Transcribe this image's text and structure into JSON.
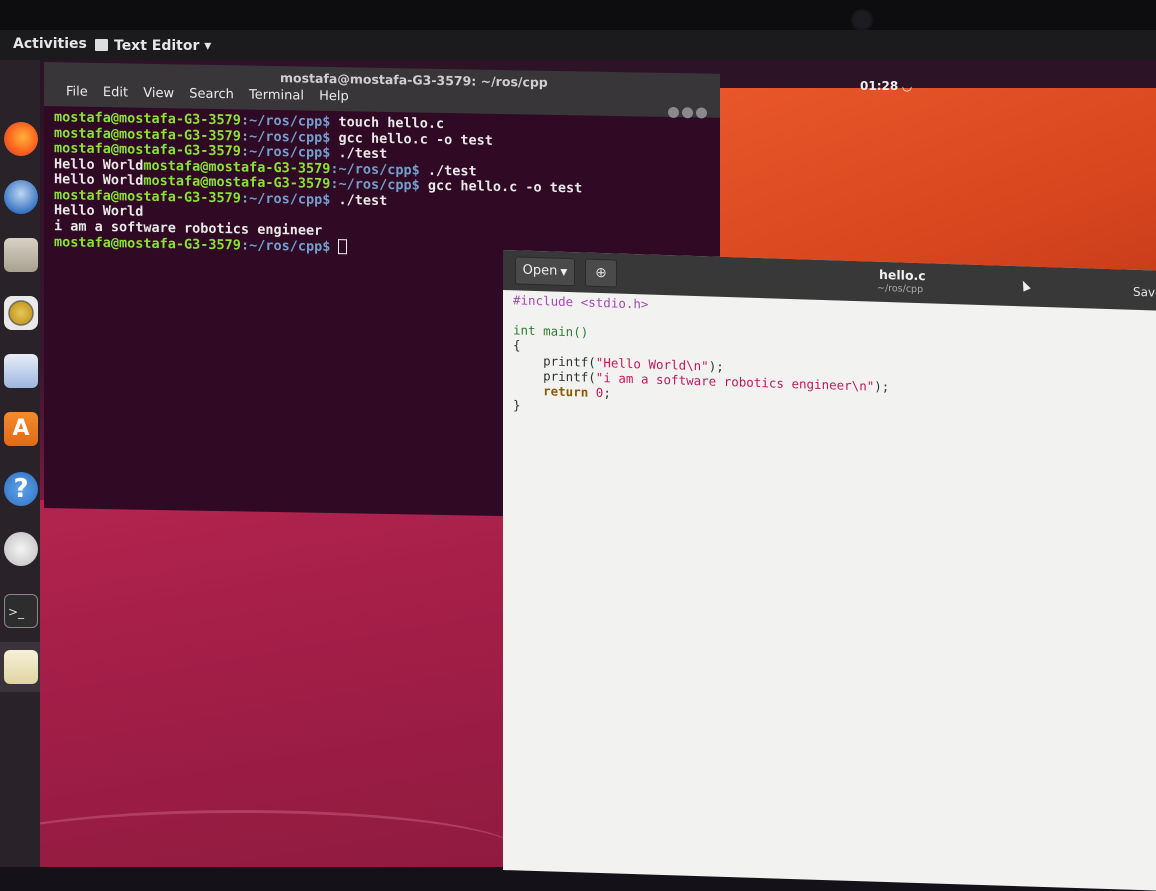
{
  "topbar": {
    "activities": "Activities",
    "app_menu": "Text Editor ▾",
    "clock": "01:28 ◡"
  },
  "terminal": {
    "title": "mostafa@mostafa-G3-3579: ~/ros/cpp",
    "menu": [
      "File",
      "Edit",
      "View",
      "Search",
      "Terminal",
      "Help"
    ],
    "lines": [
      {
        "output": "",
        "user": "mostafa@mostafa-G3-3579",
        "path": ":~/ros/cpp$",
        "cmd": " touch hello.c"
      },
      {
        "output": "",
        "user": "mostafa@mostafa-G3-3579",
        "path": ":~/ros/cpp$",
        "cmd": " gcc hello.c -o test"
      },
      {
        "output": "",
        "user": "mostafa@mostafa-G3-3579",
        "path": ":~/ros/cpp$",
        "cmd": " ./test"
      },
      {
        "output": "Hello World",
        "user": "mostafa@mostafa-G3-3579",
        "path": ":~/ros/cpp$",
        "cmd": " ./test"
      },
      {
        "output": "Hello World",
        "user": "mostafa@mostafa-G3-3579",
        "path": ":~/ros/cpp$",
        "cmd": " gcc hello.c -o test"
      },
      {
        "output": "",
        "user": "mostafa@mostafa-G3-3579",
        "path": ":~/ros/cpp$",
        "cmd": " ./test"
      },
      {
        "output": "Hello World",
        "user": "",
        "path": "",
        "cmd": ""
      },
      {
        "output": "i am a software robotics engineer",
        "user": "",
        "path": "",
        "cmd": ""
      },
      {
        "output": "",
        "user": "mostafa@mostafa-G3-3579",
        "path": ":~/ros/cpp$",
        "cmd": " "
      }
    ]
  },
  "gedit": {
    "open_label": "Open",
    "doc_title": "hello.c",
    "doc_path": "~/ros/cpp",
    "save_label": "Save",
    "code": {
      "include": "#include <stdio.h>",
      "main_sig": "int main()",
      "open_brace": "{",
      "printf1_head": "    printf(",
      "printf1_str": "\"Hello World\\n\"",
      "printf1_tail": ");",
      "printf2_head": "    printf(",
      "printf2_str": "\"i am a software robotics engineer\\n\"",
      "printf2_tail": ");",
      "return_kw": "    return",
      "return_val": " 0",
      "return_tail": ";",
      "close_brace": "}"
    }
  },
  "colors": {
    "terminal_bg": "#300a24",
    "prompt_user": "#8ae234",
    "prompt_path": "#729fcf",
    "wallpaper_orange": "#e8562a",
    "wallpaper_pink": "#a31e48"
  },
  "dock_icons": [
    "firefox-icon",
    "thunderbird-icon",
    "files-icon",
    "rhythmbox-icon",
    "writer-icon",
    "software-center-icon",
    "help-icon",
    "amazon-icon",
    "terminal-icon",
    "text-editor-icon"
  ]
}
